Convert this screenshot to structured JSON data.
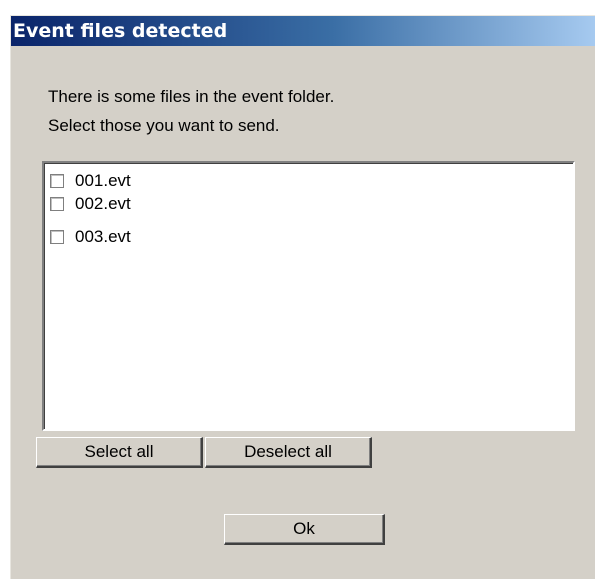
{
  "dialog": {
    "title": "Event files detected",
    "message_line1": "There is some files in the event folder.",
    "message_line2": "Select those you want to send."
  },
  "files": [
    {
      "label": "001.evt",
      "checked": false
    },
    {
      "label": "002.evt",
      "checked": false
    },
    {
      "label": "003.evt",
      "checked": false
    }
  ],
  "buttons": {
    "select_all": "Select all",
    "deselect_all": "Deselect all",
    "ok": "Ok"
  }
}
